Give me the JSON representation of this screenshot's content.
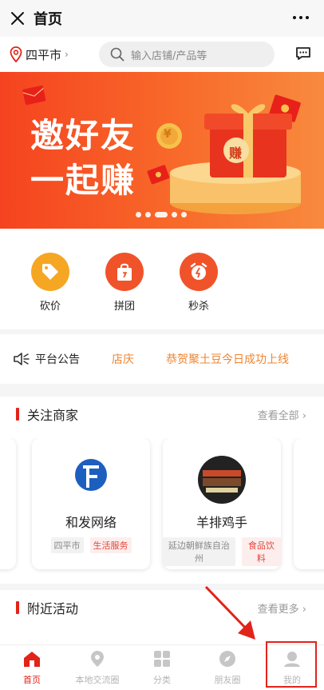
{
  "titlebar": {
    "title": "首页",
    "close_icon": "close-icon",
    "more_icon": "more-icon"
  },
  "location": {
    "city": "四平市"
  },
  "search": {
    "placeholder": "输入店铺/产品等"
  },
  "banner": {
    "line1": "邀好友",
    "line2": "一起赚",
    "gift_text": "赚",
    "coin_text": "¥"
  },
  "quick": [
    {
      "label": "砍价",
      "color": "#f5a623"
    },
    {
      "label": "拼团",
      "color": "#f0532a"
    },
    {
      "label": "秒杀",
      "color": "#f0532a"
    }
  ],
  "notice": {
    "title": "平台公告",
    "tag": "店庆",
    "text": "恭贺聚土豆今日成功上线"
  },
  "follow": {
    "title": "关注商家",
    "more": "查看全部",
    "shops": [
      {
        "name": "和发网络",
        "logo_text": "和发网络",
        "city": "四平市",
        "category": "生活服务"
      },
      {
        "name": "羊排鸡手",
        "city": "延边朝鲜族自治州",
        "category": "食品饮料"
      }
    ]
  },
  "nearby": {
    "title": "附近活动",
    "more": "查看更多"
  },
  "tabs": [
    {
      "label": "首页",
      "active": true
    },
    {
      "label": "本地交流圈",
      "active": false
    },
    {
      "label": "分类",
      "active": false
    },
    {
      "label": "朋友圈",
      "active": false
    },
    {
      "label": "我的",
      "active": false
    }
  ],
  "colors": {
    "accent": "#e2231a",
    "notice": "#ee8533",
    "banner": "#f5431f"
  }
}
